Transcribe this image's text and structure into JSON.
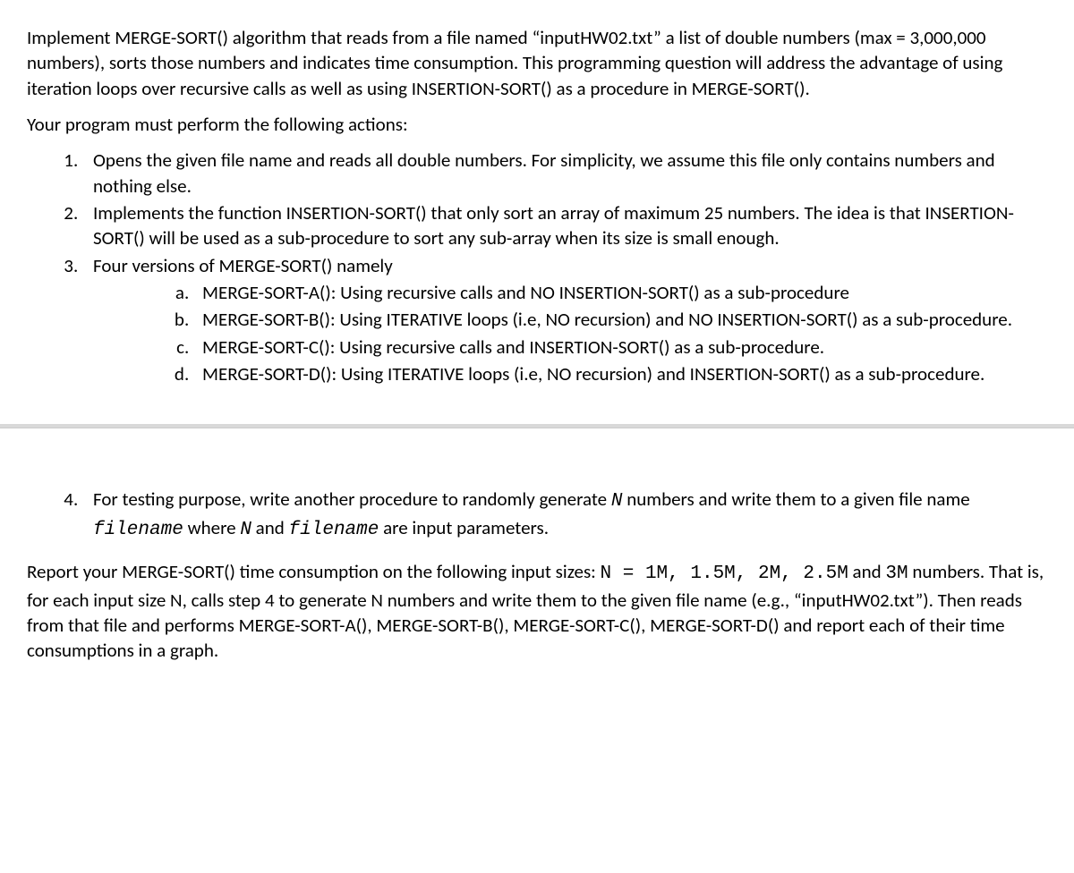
{
  "intro": {
    "p1": "Implement MERGE-SORT() algorithm that reads from a file named “inputHW02.txt” a list of double numbers (max = 3,000,000 numbers), sorts those numbers and indicates time consumption. This programming question will address the advantage of using iteration loops over recursive calls as well as using INSERTION-SORT() as a procedure in MERGE-SORT().",
    "p2": "Your program must perform the following actions:"
  },
  "steps": {
    "s1": "Opens the given file name and reads all double numbers. For simplicity, we assume this file only contains numbers and nothing else.",
    "s2": "Implements the function INSERTION-SORT() that only sort an array of maximum 25 numbers. The idea is that INSERTION-SORT() will be used as a sub-procedure to sort any sub-array when its size is small enough.",
    "s3": "Four versions of MERGE-SORT() namely",
    "s3a": "MERGE-SORT-A(): Using recursive calls and NO INSERTION-SORT() as a sub-procedure",
    "s3b": "MERGE-SORT-B(): Using ITERATIVE loops (i.e, NO recursion) and NO INSERTION-SORT() as a sub-procedure.",
    "s3c": "MERGE-SORT-C(): Using recursive calls and INSERTION-SORT() as a sub-procedure.",
    "s3d": "MERGE-SORT-D(): Using ITERATIVE loops (i.e, NO recursion) and INSERTION-SORT() as a sub-procedure.",
    "s4_pre": "For testing purpose, write another procedure to randomly generate ",
    "s4_N1": "N",
    "s4_mid1": " numbers and write them to a given file name ",
    "s4_fn1": "filename",
    "s4_mid2": " where ",
    "s4_N2": "N",
    "s4_mid3": " and ",
    "s4_fn2": "filename",
    "s4_post": " are input parameters."
  },
  "report": {
    "r1_pre": "Report your MERGE-SORT() time consumption on the following input sizes: ",
    "r1_code": "N = 1M, 1.5M, 2M, 2.5M",
    "r1_mid": " and ",
    "r1_code2": "3M",
    "r1_post": " numbers. That is, for each input size N, calls step 4 to generate N numbers and write them to the given file name (e.g., “inputHW02.txt”). Then reads from that file and performs MERGE-SORT-A(), MERGE-SORT-B(), MERGE-SORT-C(), MERGE-SORT-D() and report each of their time consumptions in a graph."
  }
}
